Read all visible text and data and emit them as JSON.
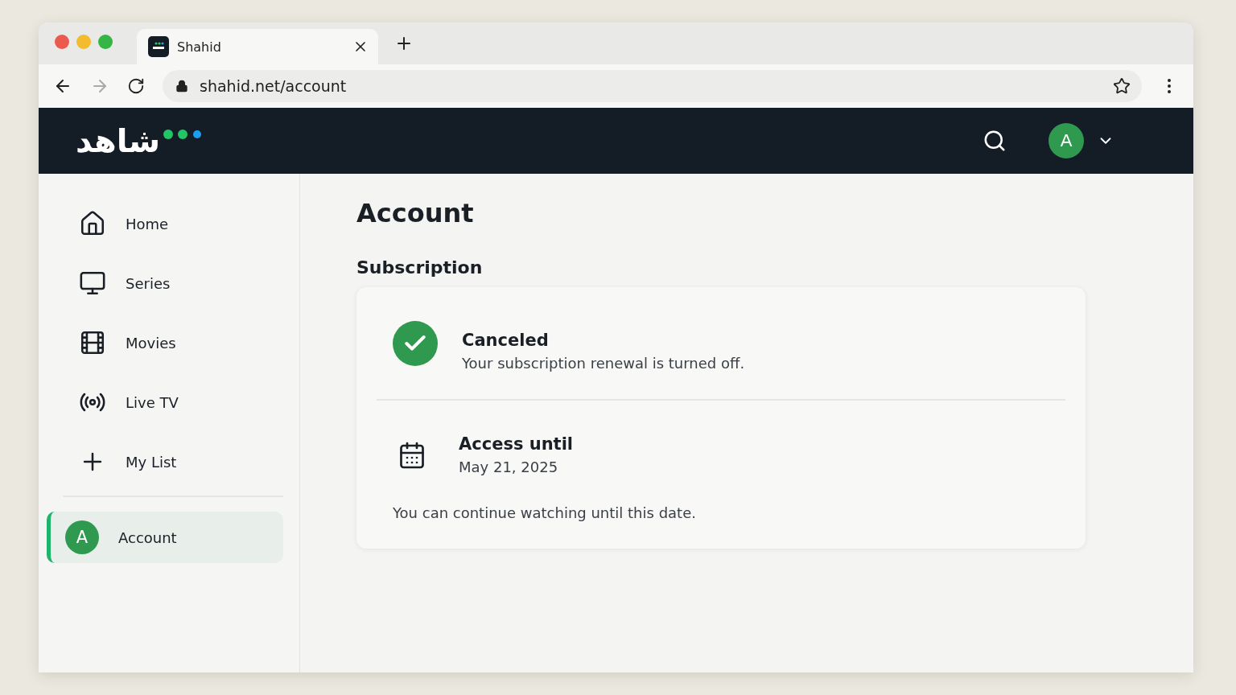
{
  "browser": {
    "tab_title": "Shahid",
    "url": "shahid.net/account"
  },
  "header": {
    "logo": "شاهد",
    "avatar": "A"
  },
  "sidebar": {
    "items": [
      {
        "label": "Home",
        "kind": "home",
        "selected": false
      },
      {
        "label": "Series",
        "kind": "monitor",
        "selected": false
      },
      {
        "label": "Movies",
        "kind": "film",
        "selected": false
      },
      {
        "label": "Live TV",
        "kind": "broadcast",
        "selected": false
      },
      {
        "label": "My List",
        "kind": "plus",
        "selected": false
      }
    ],
    "account": {
      "label": "Account",
      "avatar": "A",
      "selected": true
    }
  },
  "page": {
    "title": "Account",
    "section": "Subscription",
    "status": {
      "title": "Canceled",
      "text": "Your subscription renewal is turned off."
    },
    "access": {
      "title": "Access until",
      "date": "May 21, 2025",
      "note": "You can continue watching until this date."
    }
  }
}
